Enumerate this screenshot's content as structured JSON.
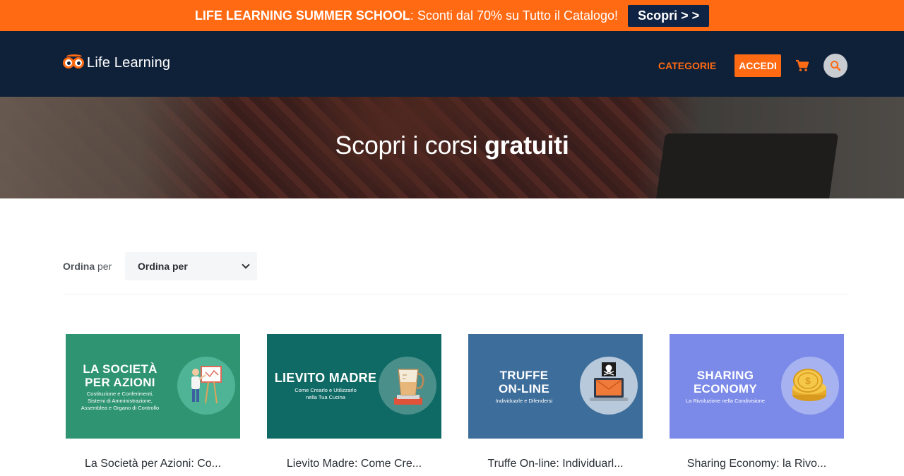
{
  "promo": {
    "title": "LIFE LEARNING SUMMER SCHOOL",
    "text": ": Sconti dal 70% su Tutto il Catalogo!",
    "button": "Scopri > >",
    "bg_color": "#ff6a13",
    "button_color": "#0f2444"
  },
  "header": {
    "logo_text": "Life Learning",
    "nav_categories": "CATEGORIE",
    "login_button": "ACCEDI",
    "cart_icon": "shopping-cart-icon",
    "search_icon": "search-icon",
    "bg_color": "#0f2139",
    "accent_color": "#ff6a13"
  },
  "hero": {
    "title_light": "Scopri i corsi ",
    "title_bold": "gratuiti"
  },
  "sort": {
    "label_bold": "Ordina",
    "label_rest": " per",
    "selected": "Ordina per"
  },
  "courses": [
    {
      "thumb_title": "LA SOCIETÀ\nPER AZIONI",
      "thumb_subtitle": "Costituzione e Conferimenti,\nSistemi di Amministrazione,\nAssemblea e Organo di Controllo",
      "thumb_color": "#2e9471",
      "title": "La Società per Azioni: Co..."
    },
    {
      "thumb_title": "LIEVITO MADRE",
      "thumb_subtitle": "Come Crearlo e Utilizzarlo\nnella Tua Cucina",
      "thumb_color": "#0f6a66",
      "title": "Lievito Madre: Come Cre..."
    },
    {
      "thumb_title": "TRUFFE\nON-LINE",
      "thumb_subtitle": "Individuarle e Difendersi",
      "thumb_color": "#3d6d9a",
      "title": "Truffe On-line: Individuarl..."
    },
    {
      "thumb_title": "SHARING\nECONOMY",
      "thumb_subtitle": "La Rivoluzione nella Condivisione",
      "thumb_color": "#7b8ae8",
      "title": "Sharing Economy: la Rivo..."
    }
  ]
}
